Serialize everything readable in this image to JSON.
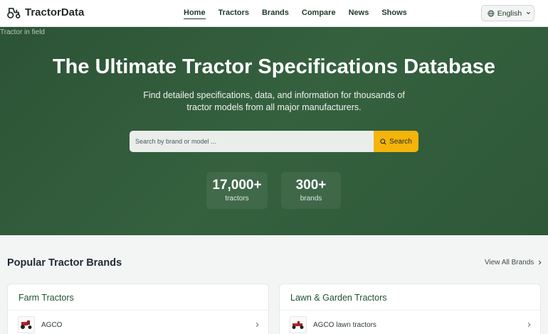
{
  "header": {
    "logo_text": "TractorData",
    "nav": [
      {
        "label": "Home",
        "active": true
      },
      {
        "label": "Tractors",
        "active": false
      },
      {
        "label": "Brands",
        "active": false
      },
      {
        "label": "Compare",
        "active": false
      },
      {
        "label": "News",
        "active": false
      },
      {
        "label": "Shows",
        "active": false
      }
    ],
    "language": "English"
  },
  "hero": {
    "image_alt": "Tractor in field",
    "title": "The Ultimate Tractor Specifications Database",
    "subtitle": "Find detailed specifications, data, and information for thousands of tractor models from all major manufacturers.",
    "search": {
      "placeholder": "Search by brand or model ...",
      "button_label": "Search"
    },
    "stats": [
      {
        "value": "17,000+",
        "label": "tractors"
      },
      {
        "value": "300+",
        "label": "brands"
      }
    ]
  },
  "brands_section": {
    "title": "Popular Tractor Brands",
    "view_all": "View All Brands",
    "cards": [
      {
        "title": "Farm Tractors",
        "items": [
          {
            "name": "AGCO"
          }
        ]
      },
      {
        "title": "Lawn & Garden Tractors",
        "items": [
          {
            "name": "AGCO lawn tractors"
          }
        ]
      }
    ]
  },
  "colors": {
    "hero_green": "#2f5a39",
    "accent_yellow": "#f4b40a",
    "card_title_green": "#1f5130"
  },
  "icons": {
    "logo": "tractor-icon",
    "language": "globe-icon",
    "search": "magnifier-icon",
    "chevron": "chevron-right-icon"
  }
}
